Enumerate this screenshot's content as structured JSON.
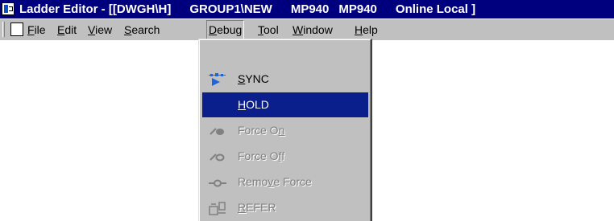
{
  "title_bar": {
    "app_title": "Ladder Editor - [[DWGH\\H]",
    "group_path": "GROUP1\\NEW",
    "device1": "MP940",
    "device2": "MP940",
    "status": "Online Local ]"
  },
  "menu_bar": {
    "items": [
      {
        "mnemonic": "F",
        "rest": "ile"
      },
      {
        "mnemonic": "E",
        "rest": "dit"
      },
      {
        "mnemonic": "V",
        "rest": "iew"
      },
      {
        "mnemonic": "S",
        "rest": "earch"
      },
      {
        "mnemonic": "D",
        "rest": "ebug"
      },
      {
        "mnemonic": "T",
        "rest": "ool"
      },
      {
        "mnemonic": "W",
        "rest": "indow"
      },
      {
        "mnemonic": "H",
        "rest": "elp"
      }
    ],
    "open_menu": "Debug"
  },
  "debug_menu": {
    "items": [
      {
        "icon": "sync-icon",
        "pre": "",
        "mnemonic": "S",
        "post": "YNC",
        "state": "enabled"
      },
      {
        "icon": "",
        "pre": "",
        "mnemonic": "H",
        "post": "OLD",
        "state": "highlighted"
      },
      {
        "icon": "force-on-icon",
        "pre": "Force O",
        "mnemonic": "n",
        "post": "",
        "state": "disabled"
      },
      {
        "icon": "force-off-icon",
        "pre": "Force O",
        "mnemonic": "f",
        "post": "f",
        "state": "disabled"
      },
      {
        "icon": "remove-force-icon",
        "pre": "Remo",
        "mnemonic": "v",
        "post": "e Force",
        "state": "disabled"
      },
      {
        "icon": "refer-icon",
        "pre": "",
        "mnemonic": "R",
        "post": "EFER",
        "state": "disabled"
      }
    ]
  },
  "colors": {
    "title_bar_bg": "#00007f",
    "menu_bg": "#c0c0c0",
    "highlight_bg": "#0a1e8c",
    "disabled_text": "#808080",
    "sync_icon": "#1e64dc"
  }
}
